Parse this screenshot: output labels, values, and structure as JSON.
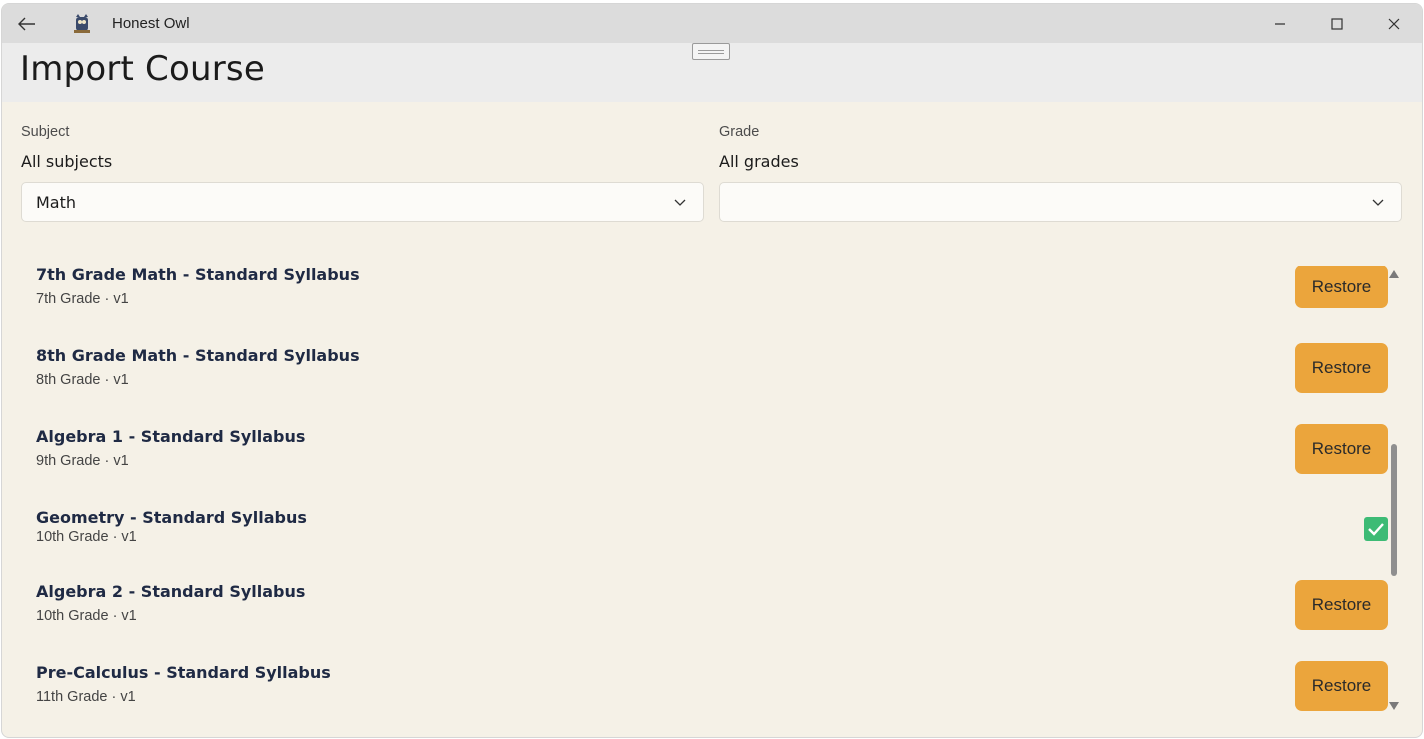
{
  "window": {
    "app_title": "Honest Owl"
  },
  "header": {
    "page_title": "Import Course"
  },
  "filters": {
    "subject": {
      "label": "Subject",
      "value_text": "All subjects",
      "selected": "Math"
    },
    "grade": {
      "label": "Grade",
      "value_text": "All grades",
      "selected": ""
    }
  },
  "courses": [
    {
      "title": "7th Grade Math - Standard Syllabus",
      "subtitle": "7th Grade · v1",
      "action": "Restore"
    },
    {
      "title": "8th Grade Math - Standard Syllabus",
      "subtitle": "8th Grade · v1",
      "action": "Restore"
    },
    {
      "title": "Algebra 1 - Standard Syllabus",
      "subtitle": "9th Grade · v1",
      "action": "Restore"
    },
    {
      "title": "Geometry - Standard Syllabus",
      "subtitle": "10th Grade · v1",
      "action": "imported",
      "checked": true
    },
    {
      "title": "Algebra 2 - Standard Syllabus",
      "subtitle": "10th Grade · v1",
      "action": "Restore"
    },
    {
      "title": "Pre-Calculus - Standard Syllabus",
      "subtitle": "11th Grade · v1",
      "action": "Restore"
    }
  ],
  "colors": {
    "accent": "#eba53c",
    "check": "#3dbb75",
    "background": "#f5f1e7"
  },
  "icons": {
    "back": "back-arrow-icon",
    "app": "owl-app-icon",
    "minimize": "minimize-icon",
    "maximize": "maximize-icon",
    "close": "close-icon",
    "dropdown": "chevron-down-icon",
    "check": "checkmark-icon"
  }
}
